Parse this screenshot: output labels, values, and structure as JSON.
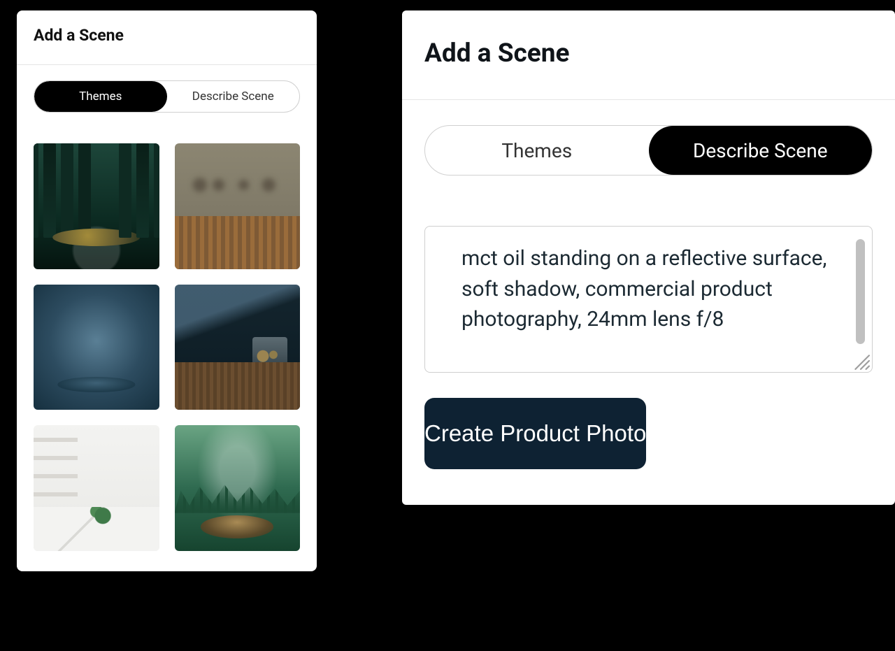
{
  "left": {
    "title": "Add a Scene",
    "tabs": {
      "themes": "Themes",
      "describe": "Describe Scene",
      "active": "themes"
    },
    "thumbs": [
      {
        "name": "forest-moss-pedestal"
      },
      {
        "name": "warm-kitchen-blurred"
      },
      {
        "name": "blue-studio-pedestal"
      },
      {
        "name": "dark-kitchen-table"
      },
      {
        "name": "white-room-marble"
      },
      {
        "name": "green-misty-forest-pedestal"
      }
    ]
  },
  "right": {
    "title": "Add a Scene",
    "tabs": {
      "themes": "Themes",
      "describe": "Describe Scene",
      "active": "describe"
    },
    "prompt_value": "mct oil standing on a reflective surface, soft shadow, commercial product photography, 24mm lens f/8",
    "cta_label": "Create Product Photo"
  },
  "colors": {
    "cta_bg": "#0e2233"
  }
}
